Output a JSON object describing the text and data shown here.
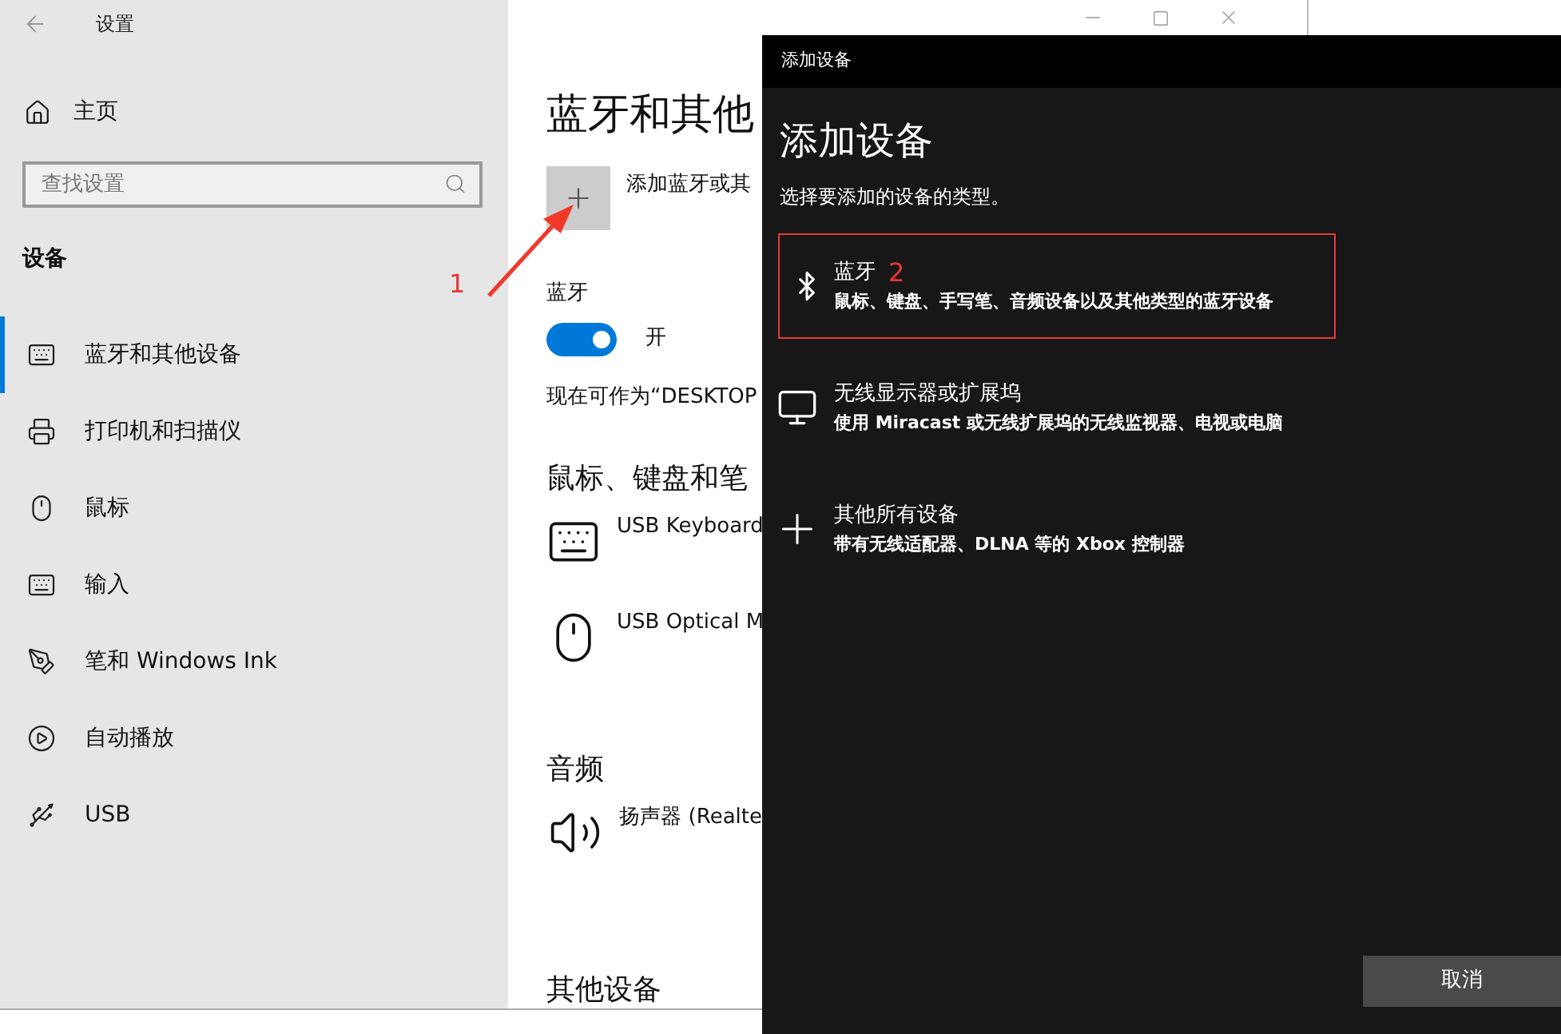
{
  "settings": {
    "title": "设置",
    "home": "主页",
    "search": {
      "placeholder": "查找设置"
    },
    "section": "设备",
    "nav": [
      {
        "kind": "bluetooth",
        "label": "蓝牙和其他设备",
        "selected": true
      },
      {
        "kind": "printer",
        "label": "打印机和扫描仪",
        "selected": false
      },
      {
        "kind": "mouse",
        "label": "鼠标",
        "selected": false
      },
      {
        "kind": "keyboard",
        "label": "输入",
        "selected": false
      },
      {
        "kind": "pen",
        "label": "笔和 Windows Ink",
        "selected": false
      },
      {
        "kind": "autoplay",
        "label": "自动播放",
        "selected": false
      },
      {
        "kind": "usb",
        "label": "USB",
        "selected": false
      }
    ],
    "content": {
      "heading": "蓝牙和其他",
      "add_label": "添加蓝牙或其",
      "bluetooth": {
        "label": "蓝牙",
        "on": true,
        "state_text": "开"
      },
      "discoverable": "现在可作为“DESKTOP",
      "groups": [
        {
          "title": "鼠标、键盘和笔",
          "devices": [
            {
              "kind": "keyboard",
              "name": "USB Keyboard"
            },
            {
              "kind": "mouse",
              "name": "USB Optical M"
            }
          ]
        },
        {
          "title": "音频",
          "devices": [
            {
              "kind": "speaker",
              "name": "扬声器 (Realte"
            }
          ]
        },
        {
          "title": "其他设备"
        }
      ]
    }
  },
  "dialog": {
    "title": "添加设备",
    "heading": "添加设备",
    "prompt": "选择要添加的设备的类型。",
    "options": [
      {
        "kind": "bluetooth",
        "title": "蓝牙",
        "description": "鼠标、键盘、手写笔、音频设备以及其他类型的蓝牙设备",
        "highlighted": true,
        "step": "2"
      },
      {
        "kind": "display",
        "title": "无线显示器或扩展坞",
        "description": "使用 Miracast 或无线扩展坞的无线监视器、电视或电脑",
        "highlighted": false
      },
      {
        "kind": "other",
        "title": "其他所有设备",
        "description": "带有无线适配器、DLNA 等的 Xbox 控制器",
        "highlighted": false
      }
    ],
    "cancel": "取消"
  },
  "annotation": {
    "step": "1"
  }
}
